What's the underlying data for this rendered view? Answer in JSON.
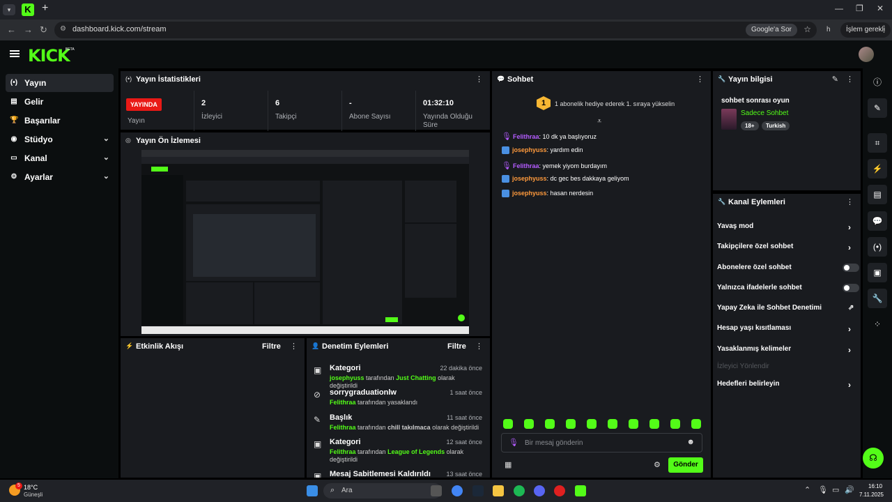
{
  "browser": {
    "url": "dashboard.kick.com/stream",
    "google_btn": "Google'a Sor",
    "profile_initial": "h",
    "action_btn": "İşlem gerekli"
  },
  "sidebar": {
    "items": [
      {
        "label": "Yayın",
        "icon": "broadcast-icon"
      },
      {
        "label": "Gelir",
        "icon": "revenue-icon"
      },
      {
        "label": "Başarılar",
        "icon": "trophy-icon"
      },
      {
        "label": "Stüdyo",
        "icon": "studio-icon"
      },
      {
        "label": "Kanal",
        "icon": "channel-icon"
      },
      {
        "label": "Ayarlar",
        "icon": "gear-icon"
      }
    ]
  },
  "stats": {
    "title": "Yayın İstatistikleri",
    "live_badge": "YAYINDA",
    "live_label": "Yayın",
    "viewers_value": "2",
    "viewers_label": "İzleyici",
    "followers_value": "6",
    "followers_label": "Takipçi",
    "subs_value": "-",
    "subs_label": "Abone Sayısı",
    "time_value": "01:32:10",
    "time_label": "Yayında Olduğu Süre"
  },
  "preview": {
    "title": "Yayın Ön İzlemesi"
  },
  "activity": {
    "title": "Etkinlik Akışı",
    "filter": "Filtre"
  },
  "moderation": {
    "title": "Denetim Eylemleri",
    "filter": "Filtre",
    "items": [
      {
        "title": "Kategori",
        "time": "22 dakika önce",
        "user": "josephyuss",
        "mid": "tarafından",
        "target": "Just Chatting",
        "end": "olarak değiştirildi"
      },
      {
        "title": "sorrygraduationlw",
        "time": "1 saat önce",
        "user": "Felithraa",
        "mid": "tarafından yasaklandı",
        "target": "",
        "end": ""
      },
      {
        "title": "Başlık",
        "time": "11 saat önce",
        "user": "Felithraa",
        "mid": "tarafından",
        "target": "chill takılmaca",
        "end": "olarak değiştirildi"
      },
      {
        "title": "Kategori",
        "time": "12 saat önce",
        "user": "Felithraa",
        "mid": "tarafından",
        "target": "League of Legends",
        "end": "olarak değiştirildi"
      },
      {
        "title": "Mesaj Sabitlemesi Kaldırıldı",
        "time": "13 saat önce",
        "user": "",
        "mid": "",
        "target": "",
        "end": ""
      }
    ]
  },
  "chat": {
    "title": "Sohbet",
    "gift_rank": "1",
    "gift_text": "1 abonelik hediye ederek 1. sıraya yükselin",
    "messages": [
      {
        "user": "Felithraa",
        "text": ": 10 dk ya başlıyoruz",
        "color": "#b45cff"
      },
      {
        "user": "josephyuss",
        "text": ": yardım edin",
        "color": "#ff9a3c"
      },
      {
        "user": "Felithraa",
        "text": ": yemek yiyom burdayım",
        "color": "#b45cff"
      },
      {
        "user": "josephyuss",
        "text": ": dc gec bes dakkaya geliyom",
        "color": "#ff9a3c"
      },
      {
        "user": "josephyuss",
        "text": ": hasan nerdesin",
        "color": "#ff9a3c"
      }
    ],
    "placeholder": "Bir mesaj gönderin",
    "send": "Gönder"
  },
  "stream_info": {
    "title": "Yayın bilgisi",
    "stream_title": "sohbet sonrası oyun",
    "category": "Sadece Sohbet",
    "tags": [
      "18+",
      "Turkish"
    ]
  },
  "channel_actions": {
    "title": "Kanal Eylemleri",
    "items": [
      {
        "label": "Yavaş mod",
        "kind": "chevron"
      },
      {
        "label": "Takipçilere özel sohbet",
        "kind": "chevron"
      },
      {
        "label": "Abonelere özel sohbet",
        "kind": "toggle"
      },
      {
        "label": "Yalnızca ifadelerle sohbet",
        "kind": "toggle"
      },
      {
        "label": "Yapay Zeka ile Sohbet Denetimi",
        "kind": "external"
      },
      {
        "label": "Hesap yaşı kısıtlaması",
        "kind": "chevron"
      },
      {
        "label": "Yasaklanmış kelimeler",
        "kind": "chevron"
      },
      {
        "label": "İzleyici Yönlendir",
        "kind": "disabled"
      },
      {
        "label": "Hedefleri belirleyin",
        "kind": "chevron"
      }
    ]
  },
  "taskbar": {
    "weather_temp": "18°C",
    "weather_desc": "Güneşli",
    "weather_badge": "5",
    "search": "Ara",
    "time": "16:10",
    "date": "7.11.2025"
  },
  "colors": {
    "brand": "#53fc18",
    "live": "#e91916",
    "panel": "#191b1f"
  }
}
